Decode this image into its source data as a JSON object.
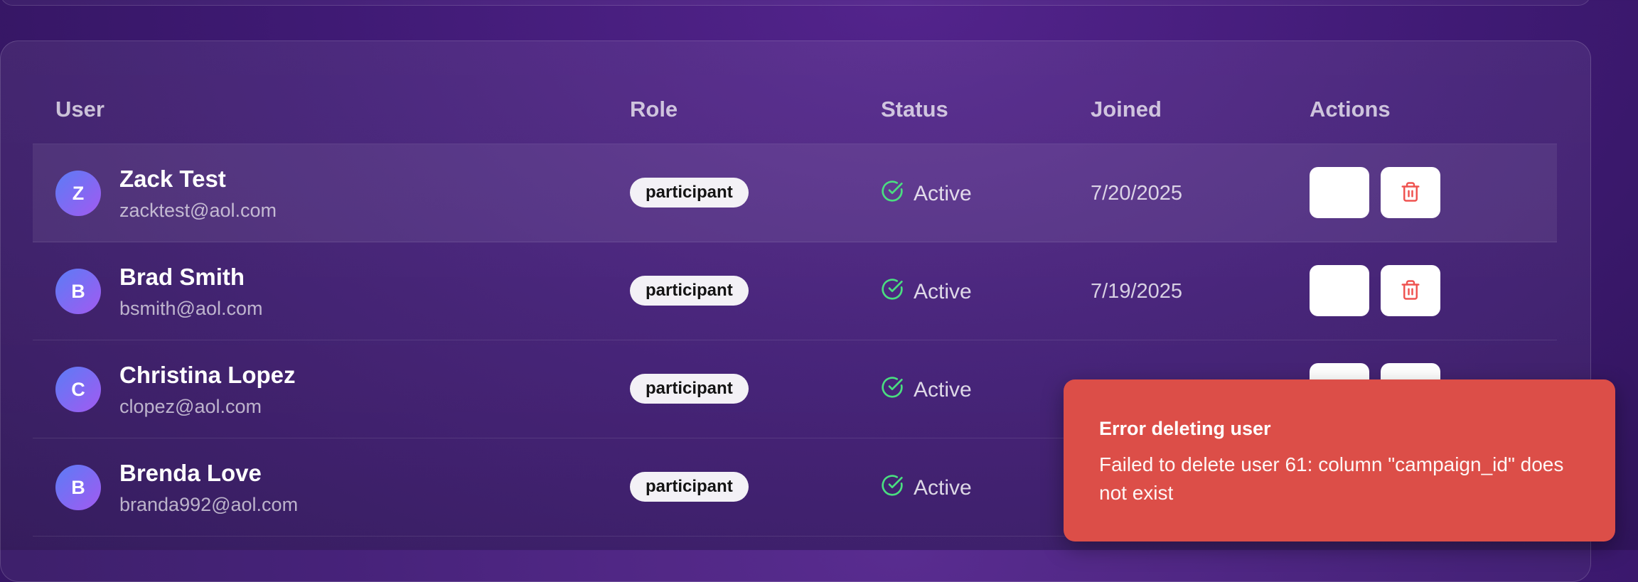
{
  "table": {
    "headers": {
      "user": "User",
      "role": "Role",
      "status": "Status",
      "joined": "Joined",
      "actions": "Actions"
    },
    "rows": [
      {
        "initial": "Z",
        "name": "Zack Test",
        "email": "zacktest@aol.com",
        "role": "participant",
        "status": "Active",
        "joined": "7/20/2025"
      },
      {
        "initial": "B",
        "name": "Brad Smith",
        "email": "bsmith@aol.com",
        "role": "participant",
        "status": "Active",
        "joined": "7/19/2025"
      },
      {
        "initial": "C",
        "name": "Christina Lopez",
        "email": "clopez@aol.com",
        "role": "participant",
        "status": "Active",
        "joined": ""
      },
      {
        "initial": "B",
        "name": "Brenda Love",
        "email": "branda992@aol.com",
        "role": "participant",
        "status": "Active",
        "joined": ""
      }
    ]
  },
  "toast": {
    "title": "Error deleting user",
    "message": "Failed to delete user 61: column \"campaign_id\" does not exist"
  },
  "icons": {
    "status": "check-circle-icon",
    "delete": "trash-icon"
  },
  "colors": {
    "active": "#4ade80",
    "danger": "#dc4e48",
    "delete_icon": "#ef5350"
  }
}
